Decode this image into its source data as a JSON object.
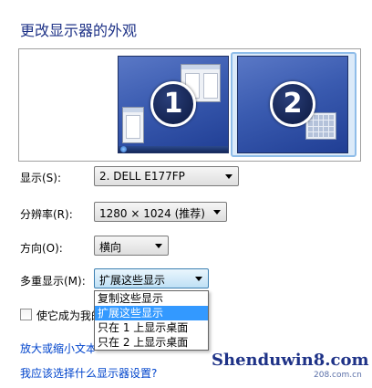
{
  "page": {
    "title": "更改显示器的外观"
  },
  "monitors": [
    {
      "number": "1",
      "selected": false
    },
    {
      "number": "2",
      "selected": true
    }
  ],
  "display": {
    "label": "显示(S):",
    "value": "2. DELL E177FP"
  },
  "resolution": {
    "label": "分辨率(R):",
    "value": "1280 × 1024 (推荐)"
  },
  "orientation": {
    "label": "方向(O):",
    "value": "横向"
  },
  "multiple_displays": {
    "label": "多重显示(M):",
    "value": "扩展这些显示",
    "options": [
      "复制这些显示",
      "扩展这些显示",
      "只在 1 上显示桌面",
      "只在 2 上显示桌面"
    ],
    "selected_index": 1
  },
  "main_display_checkbox": {
    "label": "使它成为我的",
    "checked": false
  },
  "links": {
    "text_size": "放大或缩小文本",
    "help": "我应该选择什么显示器设置?"
  },
  "watermark": {
    "text": "Shenduwin8.com",
    "sub": "208.com.cn"
  },
  "colors": {
    "title": "#1e3287",
    "link": "#0044cc",
    "selection": "#3399ff"
  }
}
